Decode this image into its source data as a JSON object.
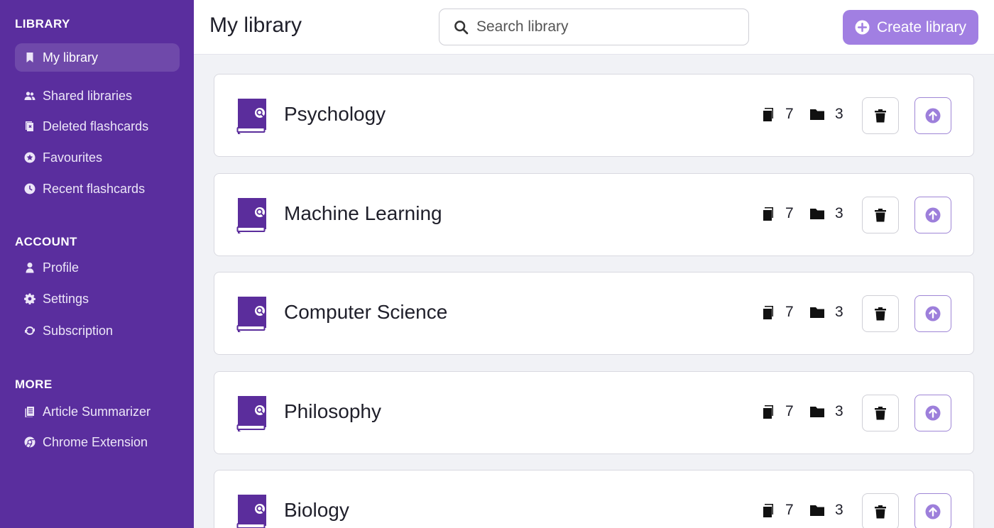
{
  "sidebar": {
    "sections": [
      {
        "title": "LIBRARY",
        "items": [
          {
            "label": "My library",
            "icon": "bookmark-icon",
            "active": true
          },
          {
            "label": "Shared libraries",
            "icon": "users-icon"
          },
          {
            "label": "Deleted flashcards",
            "icon": "deleted-cards-icon"
          },
          {
            "label": "Favourites",
            "icon": "star-circle-icon"
          },
          {
            "label": "Recent flashcards",
            "icon": "clock-icon"
          }
        ]
      },
      {
        "title": "ACCOUNT",
        "items": [
          {
            "label": "Profile",
            "icon": "user-icon"
          },
          {
            "label": "Settings",
            "icon": "gear-icon"
          },
          {
            "label": "Subscription",
            "icon": "refresh-icon"
          }
        ]
      },
      {
        "title": "MORE",
        "items": [
          {
            "label": "Article Summarizer",
            "icon": "article-icon"
          },
          {
            "label": "Chrome Extension",
            "icon": "chrome-icon"
          }
        ]
      }
    ]
  },
  "header": {
    "title": "My library",
    "search_placeholder": "Search library",
    "create_label": "Create library"
  },
  "libraries": [
    {
      "name": "Psychology",
      "cards": "7",
      "folders": "3"
    },
    {
      "name": "Machine Learning",
      "cards": "7",
      "folders": "3"
    },
    {
      "name": "Computer Science",
      "cards": "7",
      "folders": "3"
    },
    {
      "name": "Philosophy",
      "cards": "7",
      "folders": "3"
    },
    {
      "name": "Biology",
      "cards": "7",
      "folders": "3"
    }
  ],
  "colors": {
    "sidebar_bg": "#5a2e9e",
    "accent": "#a17fe2",
    "book_icon": "#5b2d9c"
  }
}
